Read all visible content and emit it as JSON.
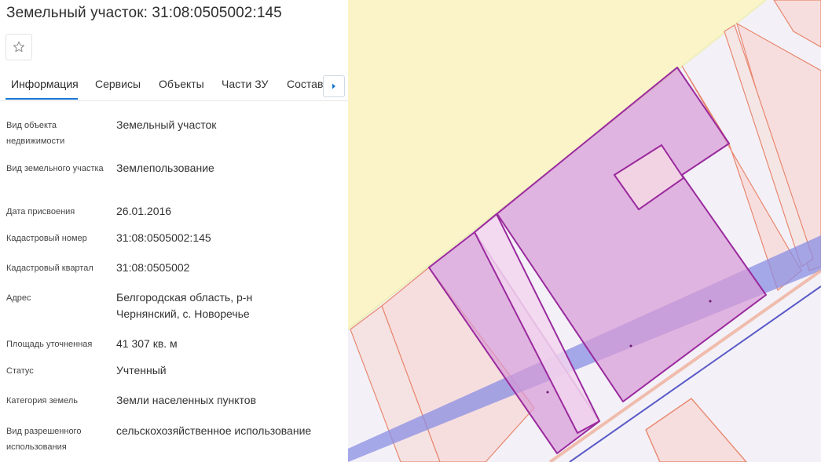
{
  "title": "Земельный участок: 31:08:0505002:145",
  "tabs": [
    {
      "label": "Информация"
    },
    {
      "label": "Сервисы"
    },
    {
      "label": "Объекты"
    },
    {
      "label": "Части ЗУ"
    },
    {
      "label": "Состав"
    }
  ],
  "fields": [
    {
      "label": "Вид объекта недвижимости",
      "value": "Земельный участок"
    },
    {
      "label": "Вид земельного участка",
      "value": "Землепользование"
    },
    {
      "label": "Дата присвоения",
      "value": "26.01.2016"
    },
    {
      "label": "Кадастровый номер",
      "value": "31:08:0505002:145"
    },
    {
      "label": "Кадастровый квартал",
      "value": "31:08:0505002"
    },
    {
      "label": "Адрес",
      "value": "Белгородская область, р-н Чернянский, с. Новоречье"
    },
    {
      "label": "Площадь уточненная",
      "value": "41 307 кв. м"
    },
    {
      "label": "Статус",
      "value": "Учтенный"
    },
    {
      "label": "Категория земель",
      "value": "Земли населенных пунктов"
    },
    {
      "label": "Вид разрешенного использования",
      "value": "сельскохозяйственное использование"
    }
  ],
  "icons": {
    "favorite": "star-outline-icon",
    "tabs_next": "caret-right-icon"
  },
  "colors": {
    "accent": "#1976d2",
    "parcel_fill": "#d79ad6",
    "parcel_stroke": "#9a2a9e",
    "neighbor_stroke": "#e8876f",
    "zone_yellow": "#faf4c8",
    "road_band": "#8a8ee3"
  }
}
